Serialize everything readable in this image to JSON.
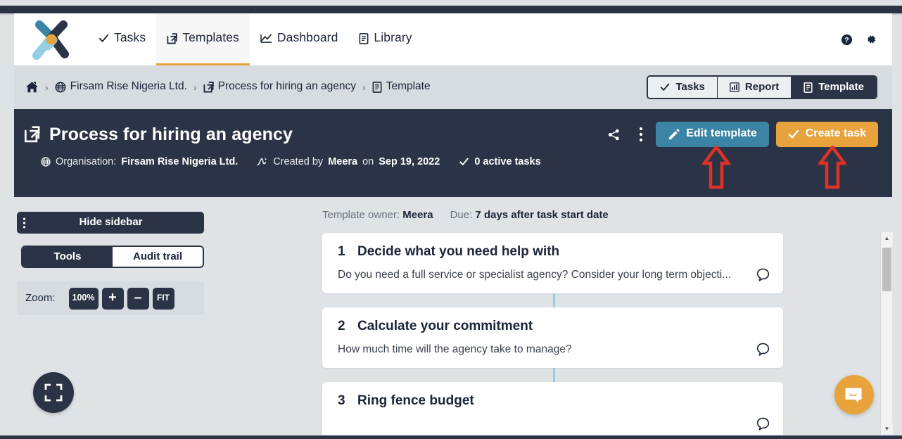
{
  "navbar": {
    "logo_name": "beesy-x-logo",
    "items": [
      {
        "label": "Tasks",
        "icon": "check-icon",
        "active": false
      },
      {
        "label": "Templates",
        "icon": "template-share-icon",
        "active": true
      },
      {
        "label": "Dashboard",
        "icon": "chart-icon",
        "active": false
      },
      {
        "label": "Library",
        "icon": "document-icon",
        "active": false
      }
    ],
    "help_icon": "help-circle-icon",
    "settings_icon": "gear-icon"
  },
  "breadcrumb": {
    "items": [
      {
        "label": "",
        "icon": "home-icon"
      },
      {
        "label": "Firsam Rise Nigeria Ltd.",
        "icon": "globe-icon"
      },
      {
        "label": "Process for hiring an agency",
        "icon": "template-share-icon"
      },
      {
        "label": "Template",
        "icon": "document-icon"
      }
    ],
    "separator": "›"
  },
  "view_toggle": {
    "options": [
      {
        "label": "Tasks",
        "icon": "check-icon",
        "active": false
      },
      {
        "label": "Report",
        "icon": "bar-chart-icon",
        "active": false
      },
      {
        "label": "Template",
        "icon": "document-icon",
        "active": true
      }
    ]
  },
  "page_header": {
    "title": "Process for hiring an agency",
    "title_icon": "template-share-icon",
    "share_icon": "share-nodes-icon",
    "more_icon": "more-vertical-icon",
    "edit_button": {
      "label": "Edit template",
      "icon": "pencil-icon",
      "color": "#3c84a5"
    },
    "create_button": {
      "label": "Create task",
      "icon": "check-icon",
      "color": "#e8a33d"
    },
    "meta": {
      "org_icon": "globe-icon",
      "org_label": "Organisation:",
      "org_value": "Firsam Rise Nigeria Ltd.",
      "author_icon": "signature-icon",
      "created_label": "Created by",
      "created_by": "Meera",
      "created_on_label": "on",
      "created_on": "Sep 19, 2022",
      "tasks_icon": "check-icon",
      "active_tasks": "0 active tasks"
    }
  },
  "annotations": {
    "arrow_color": "#e03127",
    "arrows": [
      {
        "name": "arrow-pointing-edit-template",
        "target": "Edit template"
      },
      {
        "name": "arrow-pointing-create-task",
        "target": "Create task"
      }
    ]
  },
  "sidebar": {
    "hide_sidebar_label": "Hide sidebar",
    "drag_icon": "more-vertical-icon",
    "tabs": [
      {
        "label": "Tools",
        "active": true
      },
      {
        "label": "Audit trail",
        "active": false
      }
    ],
    "zoom": {
      "label": "Zoom:",
      "level": "100%",
      "zoom_in": "+",
      "zoom_out": "–",
      "fit": "FIT"
    },
    "expand_fab_icon": "expand-fullscreen-icon"
  },
  "main": {
    "owner_label": "Template owner:",
    "owner_value": "Meera",
    "due_label": "Due:",
    "due_value": "7 days after task start date",
    "steps": [
      {
        "number": "1",
        "title": "Decide what you need help with",
        "description": "Do you need a full service or specialist agency? Consider your long term objecti...",
        "comment_icon": "comment-icon"
      },
      {
        "number": "2",
        "title": "Calculate your commitment",
        "description": "How much time will the agency take to manage?",
        "comment_icon": "comment-icon"
      },
      {
        "number": "3",
        "title": "Ring fence budget",
        "description": "",
        "comment_icon": "comment-icon"
      }
    ]
  },
  "scrollbar": {
    "up_arrow": "▲",
    "down_arrow": "▼"
  },
  "chat_widget": {
    "icon": "chat-smile-icon",
    "color": "#e8a33d"
  },
  "colors": {
    "dark": "#2b3446",
    "page_bg": "#dfe3e6",
    "crumb_bg": "#d7dce1",
    "accent_orange": "#e8a33d",
    "accent_blue": "#3c84a5",
    "connector": "#93cee2",
    "annotation_red": "#e03127"
  }
}
